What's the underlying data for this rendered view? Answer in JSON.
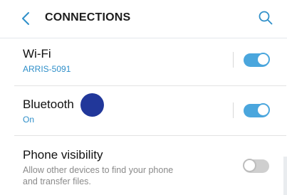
{
  "header": {
    "title": "CONNECTIONS",
    "back_icon": "chevron-left-icon",
    "search_icon": "search-icon",
    "accent_color": "#2f8fc9"
  },
  "rows": [
    {
      "label": "Wi-Fi",
      "subtitle": "ARRIS-5091",
      "toggle_on": true
    },
    {
      "label": "Bluetooth",
      "subtitle": "On",
      "toggle_on": true
    },
    {
      "label": "Phone visibility",
      "description": "Allow other devices to find your phone and transfer files.",
      "toggle_on": false
    }
  ],
  "colors": {
    "toggle_on": "#4aa6dd",
    "toggle_off": "#cfcfcf",
    "touch_indicator": "#21379a"
  }
}
